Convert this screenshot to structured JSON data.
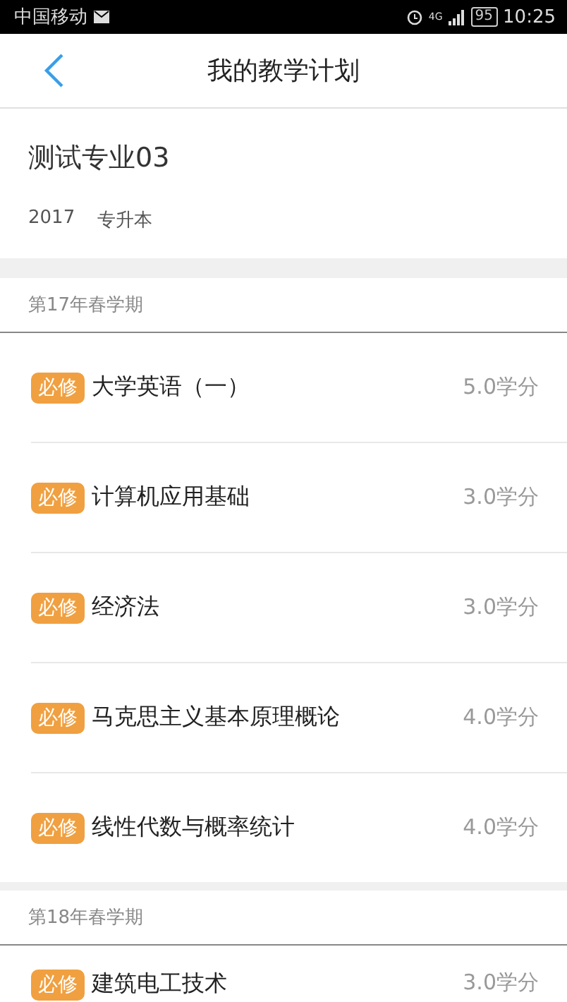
{
  "status_bar": {
    "carrier": "中国移动",
    "network": "4G",
    "battery": "95",
    "time": "10:25"
  },
  "header": {
    "title": "我的教学计划"
  },
  "plan": {
    "major": "测试专业03",
    "year": "2017",
    "type": "专升本"
  },
  "semesters": [
    {
      "title": "第17年春学期",
      "courses": [
        {
          "badge": "必修",
          "name": "大学英语（一）",
          "credits": "5.0学分"
        },
        {
          "badge": "必修",
          "name": "计算机应用基础",
          "credits": "3.0学分"
        },
        {
          "badge": "必修",
          "name": "经济法",
          "credits": "3.0学分"
        },
        {
          "badge": "必修",
          "name": "马克思主义基本原理概论",
          "credits": "4.0学分"
        },
        {
          "badge": "必修",
          "name": "线性代数与概率统计",
          "credits": "4.0学分"
        }
      ]
    },
    {
      "title": "第18年春学期",
      "courses": [
        {
          "badge": "必修",
          "name": "建筑电工技术",
          "credits": "3.0学分"
        }
      ]
    }
  ]
}
